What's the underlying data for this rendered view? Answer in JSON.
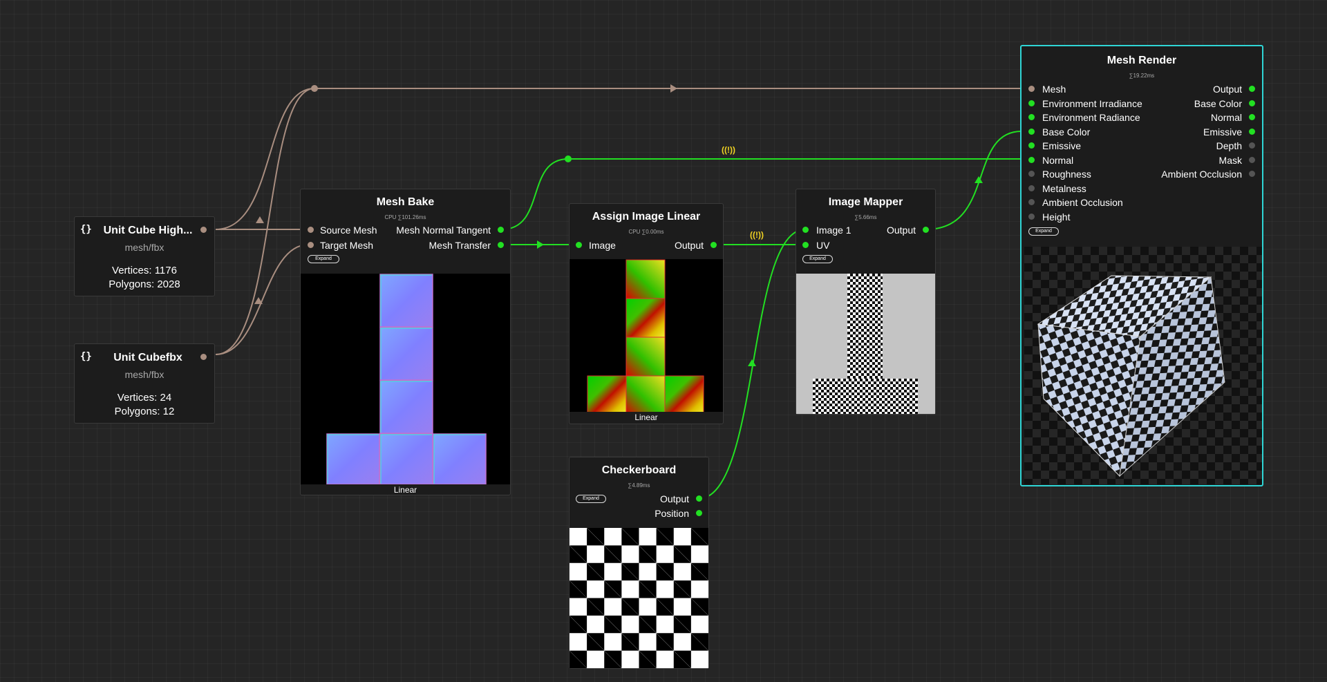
{
  "source_nodes": [
    {
      "title": "Unit Cube High...",
      "type": "mesh/fbx",
      "vertices": "Vertices: 1176",
      "polygons": "Polygons: 2028"
    },
    {
      "title": "Unit Cubefbx",
      "type": "mesh/fbx",
      "vertices": "Vertices: 24",
      "polygons": "Polygons: 12"
    }
  ],
  "mesh_bake": {
    "title": "Mesh Bake",
    "timing": "CPU ∑101.26ms",
    "inputs": [
      "Source Mesh",
      "Target Mesh"
    ],
    "outputs": [
      "Mesh Normal Tangent",
      "Mesh Transfer"
    ],
    "expand": "Expand",
    "caption": "Linear"
  },
  "assign_image": {
    "title": "Assign Image Linear",
    "timing": "CPU ∑0.00ms",
    "input": "Image",
    "output": "Output",
    "caption": "Linear"
  },
  "image_mapper": {
    "title": "Image Mapper",
    "timing": "∑5.66ms",
    "inputs": [
      "Image 1",
      "UV"
    ],
    "output": "Output",
    "expand": "Expand"
  },
  "checkerboard": {
    "title": "Checkerboard",
    "timing": "∑4.89ms",
    "expand": "Expand",
    "outputs": [
      "Output",
      "Position"
    ]
  },
  "mesh_render": {
    "title": "Mesh Render",
    "timing": "∑19.22ms",
    "inputs": [
      {
        "label": "Mesh",
        "state": "tan"
      },
      {
        "label": "Environment Irradiance",
        "state": "green"
      },
      {
        "label": "Environment Radiance",
        "state": "green"
      },
      {
        "label": "Base Color",
        "state": "green"
      },
      {
        "label": "Emissive",
        "state": "green"
      },
      {
        "label": "Normal",
        "state": "green"
      },
      {
        "label": "Roughness",
        "state": "gray"
      },
      {
        "label": "Metalness",
        "state": "gray"
      },
      {
        "label": "Ambient Occlusion",
        "state": "gray"
      },
      {
        "label": "Height",
        "state": "gray"
      }
    ],
    "outputs": [
      {
        "label": "Output",
        "state": "green"
      },
      {
        "label": "Base Color",
        "state": "green"
      },
      {
        "label": "Normal",
        "state": "green"
      },
      {
        "label": "Emissive",
        "state": "green"
      },
      {
        "label": "Depth",
        "state": "gray"
      },
      {
        "label": "Mask",
        "state": "gray"
      },
      {
        "label": "Ambient Occlusion",
        "state": "gray"
      }
    ],
    "expand": "Expand"
  },
  "warnings": [
    "((!))",
    "((!))"
  ],
  "colors": {
    "wire_mesh": "#a98e80",
    "wire_image": "#22e022",
    "selected": "#2fd6d6",
    "warning": "#f2d422"
  }
}
